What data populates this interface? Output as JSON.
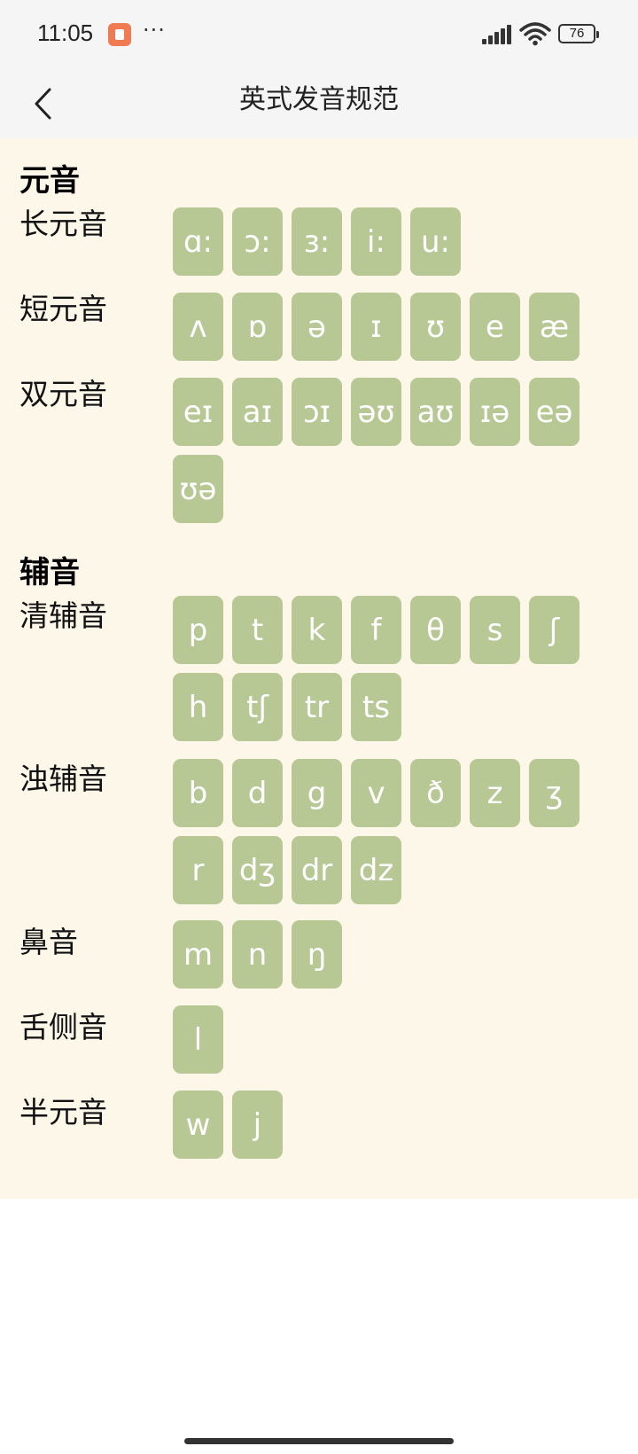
{
  "status_bar": {
    "time": "11:05",
    "more": "···",
    "battery": "76"
  },
  "header": {
    "title": "英式发音规范"
  },
  "vowels": {
    "title": "元音",
    "long": {
      "label": "长元音",
      "symbols": [
        "ɑ:",
        "ɔ:",
        "ɜ:",
        "i:",
        "u:"
      ]
    },
    "short": {
      "label": "短元音",
      "symbols": [
        "ʌ",
        "ɒ",
        "ə",
        "ɪ",
        "ʊ",
        "e",
        "æ"
      ]
    },
    "diphthong": {
      "label": "双元音",
      "symbols": [
        "eɪ",
        "aɪ",
        "ɔɪ",
        "əʊ",
        "aʊ",
        "ɪə",
        "eə",
        "ʊə"
      ]
    }
  },
  "consonants": {
    "title": "辅音",
    "voiceless": {
      "label": "清辅音",
      "symbols": [
        "p",
        "t",
        "k",
        "f",
        "θ",
        "s",
        "ʃ",
        "h",
        "tʃ",
        "tr",
        "ts"
      ]
    },
    "voiced": {
      "label": "浊辅音",
      "symbols": [
        "b",
        "d",
        "g",
        "v",
        "ð",
        "z",
        "ʒ",
        "r",
        "dʒ",
        "dr",
        "dz"
      ]
    },
    "nasal": {
      "label": "鼻音",
      "symbols": [
        "m",
        "n",
        "ŋ"
      ]
    },
    "lateral": {
      "label": "舌侧音",
      "symbols": [
        "l"
      ]
    },
    "semivowel": {
      "label": "半元音",
      "symbols": [
        "w",
        "j"
      ]
    }
  },
  "colors": {
    "tile_bg": "#b7c894",
    "content_bg": "#fcf7e8",
    "tile_text": "#ffffff"
  }
}
